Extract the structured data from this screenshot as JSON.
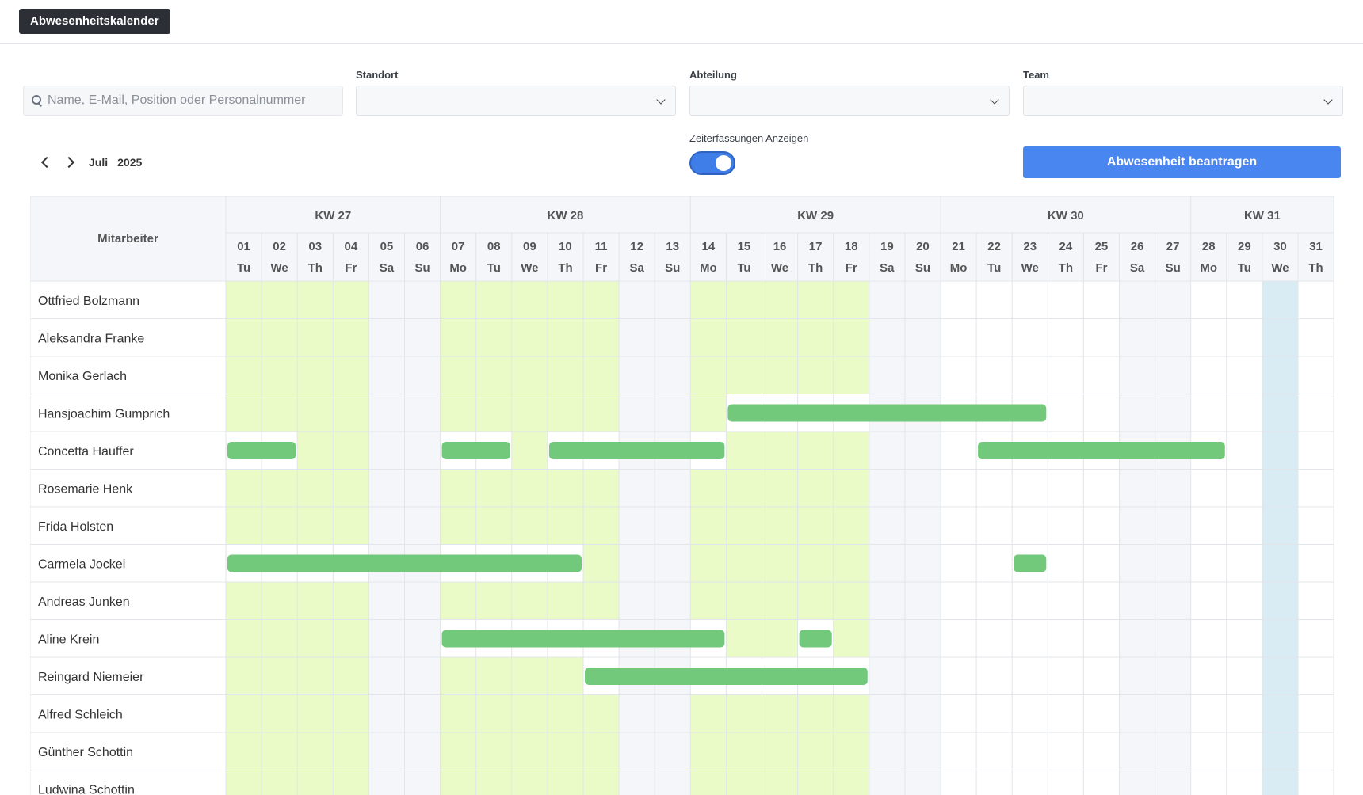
{
  "app": {
    "title": "Abwesenheitskalender"
  },
  "search": {
    "placeholder": "Name, E-Mail, Position oder Personalnummer",
    "value": ""
  },
  "filters": [
    {
      "label": "Standort",
      "value": ""
    },
    {
      "label": "Abteilung",
      "value": ""
    },
    {
      "label": "Team",
      "value": ""
    }
  ],
  "navigation": {
    "month": "Juli",
    "year": "2025"
  },
  "toggle": {
    "label": "Zeiterfassungen Anzeigen",
    "on": true
  },
  "request_button": {
    "label": "Abwesenheit beantragen"
  },
  "calendar": {
    "employee_header": "Mitarbeiter",
    "today_day": 30,
    "weeks": [
      {
        "label": "KW 27",
        "first_day": 1,
        "last_day": 6
      },
      {
        "label": "KW 28",
        "first_day": 7,
        "last_day": 13
      },
      {
        "label": "KW 29",
        "first_day": 14,
        "last_day": 20
      },
      {
        "label": "KW 30",
        "first_day": 21,
        "last_day": 27
      },
      {
        "label": "KW 31",
        "first_day": 28,
        "last_day": 31
      }
    ],
    "days": [
      {
        "num": "01",
        "dow": "Tu"
      },
      {
        "num": "02",
        "dow": "We"
      },
      {
        "num": "03",
        "dow": "Th"
      },
      {
        "num": "04",
        "dow": "Fr"
      },
      {
        "num": "05",
        "dow": "Sa"
      },
      {
        "num": "06",
        "dow": "Su"
      },
      {
        "num": "07",
        "dow": "Mo"
      },
      {
        "num": "08",
        "dow": "Tu"
      },
      {
        "num": "09",
        "dow": "We"
      },
      {
        "num": "10",
        "dow": "Th"
      },
      {
        "num": "11",
        "dow": "Fr"
      },
      {
        "num": "12",
        "dow": "Sa"
      },
      {
        "num": "13",
        "dow": "Su"
      },
      {
        "num": "14",
        "dow": "Mo"
      },
      {
        "num": "15",
        "dow": "Tu"
      },
      {
        "num": "16",
        "dow": "We"
      },
      {
        "num": "17",
        "dow": "Th"
      },
      {
        "num": "18",
        "dow": "Fr"
      },
      {
        "num": "19",
        "dow": "Sa"
      },
      {
        "num": "20",
        "dow": "Su"
      },
      {
        "num": "21",
        "dow": "Mo"
      },
      {
        "num": "22",
        "dow": "Tu"
      },
      {
        "num": "23",
        "dow": "We"
      },
      {
        "num": "24",
        "dow": "Th"
      },
      {
        "num": "25",
        "dow": "Fr"
      },
      {
        "num": "26",
        "dow": "Sa"
      },
      {
        "num": "27",
        "dow": "Su"
      },
      {
        "num": "28",
        "dow": "Mo"
      },
      {
        "num": "29",
        "dow": "Tu"
      },
      {
        "num": "30",
        "dow": "We"
      },
      {
        "num": "31",
        "dow": "Th"
      }
    ],
    "employees": [
      {
        "name": "Ottfried Bolzmann",
        "absences": []
      },
      {
        "name": "Aleksandra Franke",
        "absences": []
      },
      {
        "name": "Monika Gerlach",
        "absences": []
      },
      {
        "name": "Hansjoachim Gumprich",
        "absences": [
          [
            15,
            23
          ]
        ]
      },
      {
        "name": "Concetta Hauffer",
        "absences": [
          [
            1,
            2
          ],
          [
            7,
            8
          ],
          [
            10,
            14
          ],
          [
            22,
            28
          ]
        ]
      },
      {
        "name": "Rosemarie Henk",
        "absences": []
      },
      {
        "name": "Frida Holsten",
        "absences": []
      },
      {
        "name": "Carmela Jockel",
        "absences": [
          [
            1,
            10
          ],
          [
            23,
            23
          ]
        ]
      },
      {
        "name": "Andreas Junken",
        "absences": []
      },
      {
        "name": "Aline Krein",
        "absences": [
          [
            7,
            14
          ],
          [
            17,
            17
          ]
        ]
      },
      {
        "name": "Reingard Niemeier",
        "absences": [
          [
            11,
            18
          ]
        ]
      },
      {
        "name": "Alfred Schleich",
        "absences": []
      },
      {
        "name": "Günther Schottin",
        "absences": []
      },
      {
        "name": "Ludwina Schottin",
        "absences": []
      }
    ],
    "colors": {
      "worked": "#eafbc8",
      "weekend": "#f4f6fa",
      "today": "#d9ebf3",
      "header": "#f4f6fa",
      "gridline": "#e2e5ea",
      "absence": "#72c97b"
    }
  }
}
